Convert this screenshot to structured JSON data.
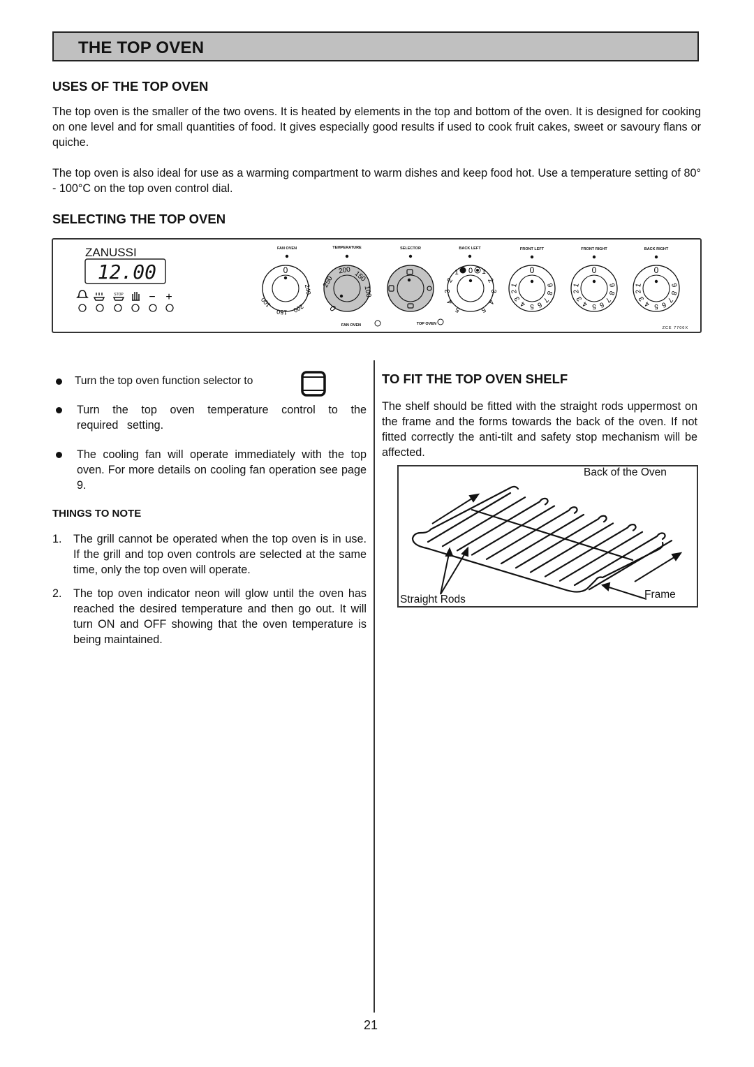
{
  "header": {
    "title": "THE TOP OVEN"
  },
  "uses": {
    "heading": "USES OF THE TOP OVEN",
    "paragraphs": [
      "The top oven is the smaller of the two ovens. It is heated by elements in the top and bottom of the oven. It is designed for cooking on one level and for small quantities of food. It gives especially good results if used to cook fruit cakes, sweet or savoury flans or quiche.",
      "The top oven is also ideal for use as a warming compartment to warm dishes and keep food hot. Use a temperature setting of 80° - 100°C  on the top oven control dial."
    ]
  },
  "selecting": {
    "heading": "SELECTING THE TOP OVEN",
    "panel": {
      "brand": "ZANUSSI",
      "clock_display": "12.00",
      "timer_buttons": [
        "bell-icon",
        "cook-time-icon",
        "stop-icon",
        "hand-icon",
        "minus-icon",
        "plus-icon"
      ],
      "timer_symbols": [
        "",
        "",
        "STOP",
        "",
        "−",
        "+"
      ],
      "knobs": [
        {
          "label": "FAN OVEN",
          "marks": [
            "0",
            "240",
            "200",
            "150",
            "100"
          ]
        },
        {
          "label": "TEMPERATURE",
          "marks": [
            "250",
            "200",
            "150",
            "100",
            "0"
          ]
        },
        {
          "label": "SELECTOR",
          "marks": []
        },
        {
          "label": "BACK LEFT",
          "marks": [
            "0",
            "1",
            "2",
            "3",
            "4",
            "5"
          ]
        },
        {
          "label": "FRONT LEFT",
          "marks": [
            "0",
            "1",
            "2",
            "3",
            "4",
            "5",
            "6",
            "7",
            "8",
            "9"
          ]
        },
        {
          "label": "FRONT RIGHT",
          "marks": [
            "0",
            "1",
            "2",
            "3",
            "4",
            "5",
            "6",
            "7",
            "8",
            "9"
          ]
        },
        {
          "label": "BACK RIGHT",
          "marks": [
            "0",
            "1",
            "2",
            "3",
            "4",
            "5",
            "6",
            "7",
            "8",
            "9"
          ]
        }
      ],
      "indicators": [
        "FAN OVEN",
        "TOP OVEN"
      ],
      "model_code": "ZCE 7700X"
    },
    "bullets": [
      "Turn the top oven function selector to",
      "Turn the top oven temperature control to the required setting.",
      "The cooling fan will operate immediately with the top oven. For more details on cooling fan operation see page 9."
    ],
    "selector_symbol": "top-oven-symbol-icon"
  },
  "things_to_note": {
    "heading": "THINGS TO NOTE",
    "items": [
      {
        "num": "1.",
        "text": "The grill cannot be operated when the top oven is in use.  If the grill and top oven controls are selected at the same time, only the top oven will operate."
      },
      {
        "num": "2.",
        "text": "The top oven indicator neon will glow until the oven has reached  the desired temperature  and then go out. It will turn ON and OFF showing that the oven temperature is being maintained."
      }
    ]
  },
  "shelf": {
    "heading": "TO FIT THE TOP OVEN SHELF",
    "paragraph": "The shelf should be fitted with the straight rods uppermost on the frame and the forms towards the back of the oven.  If not fitted correctly the anti-tilt and safety stop mechanism  will be affected.",
    "diagram_labels": {
      "back": "Back of the Oven",
      "rods": "Straight Rods",
      "frame": "Frame"
    }
  },
  "footer": {
    "page_number": "21"
  }
}
